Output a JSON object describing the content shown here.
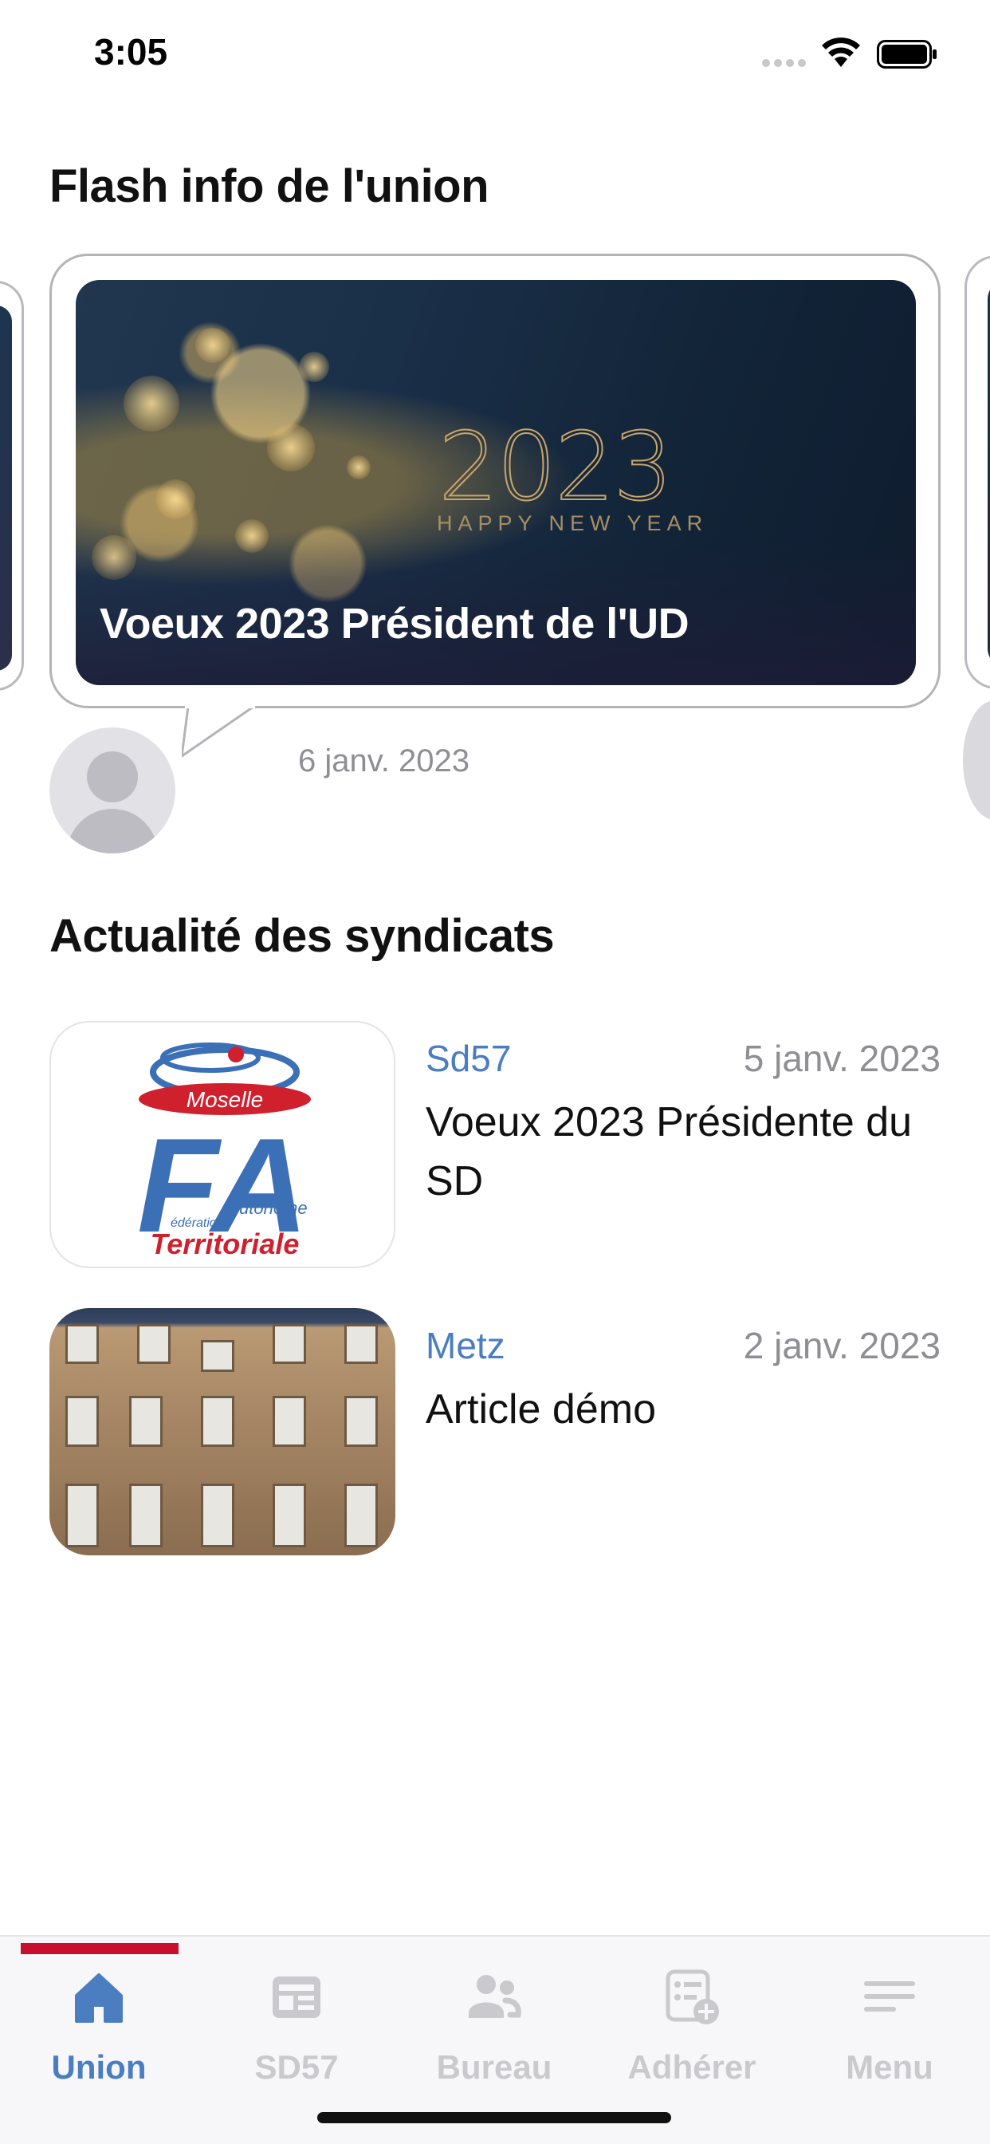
{
  "status_bar": {
    "time": "3:05"
  },
  "flash": {
    "section_title": "Flash info de l'union",
    "card": {
      "caption": "Voeux 2023 Président de l'UD",
      "image_year": "2023",
      "image_subtitle": "HAPPY NEW YEAR",
      "date": "6 janv. 2023"
    }
  },
  "news": {
    "section_title": "Actualité des syndicats",
    "items": [
      {
        "source": "Sd57",
        "date": "5 janv. 2023",
        "headline": "Voeux 2023 Présidente du SD",
        "thumb_logo_text": [
          "Moselle",
          "FA",
          "utonome",
          "édération",
          "Territoriale"
        ]
      },
      {
        "source": "Metz",
        "date": "2 janv. 2023",
        "headline": "Article démo"
      }
    ]
  },
  "tab_bar": {
    "tabs": [
      {
        "label": "Union",
        "icon": "home-icon",
        "active": true
      },
      {
        "label": "SD57",
        "icon": "newspaper-icon",
        "active": false
      },
      {
        "label": "Bureau",
        "icon": "people-icon",
        "active": false
      },
      {
        "label": "Adhérer",
        "icon": "form-add-icon",
        "active": false
      },
      {
        "label": "Menu",
        "icon": "menu-icon",
        "active": false
      }
    ]
  },
  "colors": {
    "accent": "#4a7ec1",
    "active_indicator": "#c8102e",
    "inactive": "#c9c9ce"
  }
}
